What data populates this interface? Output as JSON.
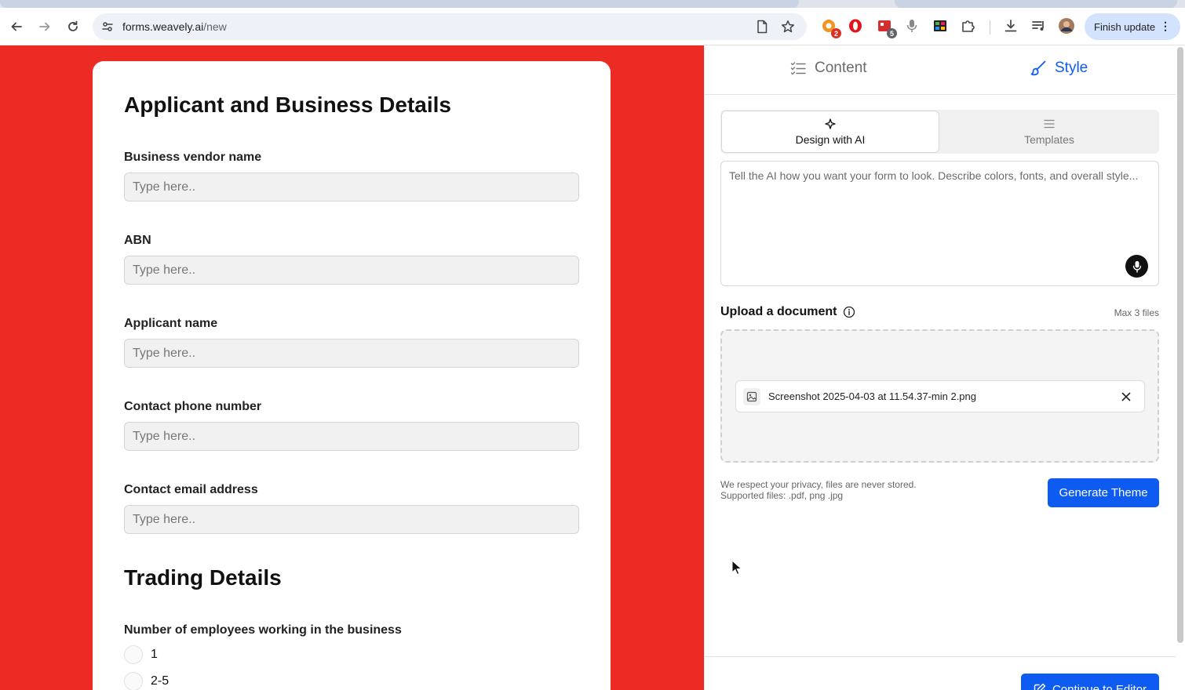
{
  "browser": {
    "url_host": "forms.weavely.ai",
    "url_path": "/new",
    "finish_update_label": "Finish update",
    "extensions": [
      {
        "icon": "ext-orange-icon",
        "badge": "2",
        "badge_color": "#d93025"
      },
      {
        "icon": "opera-icon",
        "badge": null
      },
      {
        "icon": "ext-red-icon",
        "badge": "5",
        "badge_color": "#5f6368"
      },
      {
        "icon": "microphone-icon",
        "badge": null
      },
      {
        "icon": "ext-colorful-icon",
        "badge": null
      },
      {
        "icon": "puzzle-icon",
        "badge": null
      }
    ]
  },
  "form": {
    "section1_title": "Applicant and Business Details",
    "fields": [
      {
        "label": "Business vendor name",
        "placeholder": "Type here.."
      },
      {
        "label": "ABN",
        "placeholder": "Type here.."
      },
      {
        "label": "Applicant name",
        "placeholder": "Type here.."
      },
      {
        "label": "Contact phone number",
        "placeholder": "Type here.."
      },
      {
        "label": "Contact email address",
        "placeholder": "Type here.."
      }
    ],
    "section2_title": "Trading Details",
    "question": "Number of employees working in the business",
    "options": [
      "1",
      "2-5"
    ],
    "background_color": "#ec2b25"
  },
  "panel": {
    "tabs": {
      "content": "Content",
      "style": "Style"
    },
    "segments": {
      "design": "Design with AI",
      "templates": "Templates"
    },
    "prompt_placeholder": "Tell the AI how you want your form to look. Describe colors, fonts, and overall style...",
    "upload_title": "Upload a document",
    "max_files": "Max 3 files",
    "file_name": "Screenshot 2025-04-03 at 11.54.37-min 2.png",
    "privacy_line1": "We respect your privacy, files are never stored.",
    "privacy_line2": "Supported files: .pdf, png .jpg",
    "generate_label": "Generate Theme",
    "continue_label": "Continue to Editor",
    "accent_color": "#0d5bf0"
  }
}
